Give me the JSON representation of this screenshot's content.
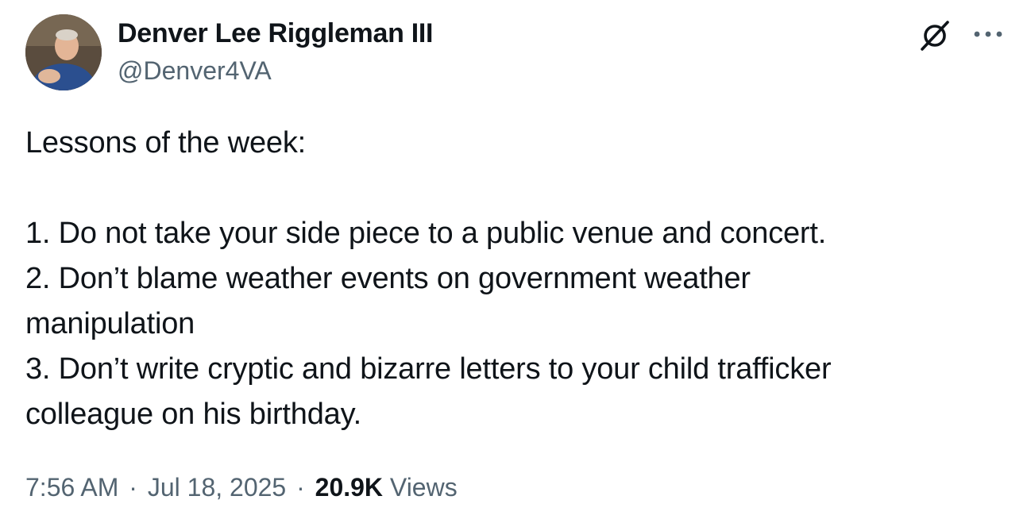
{
  "author": {
    "display_name": "Denver Lee Riggleman III",
    "handle": "@Denver4VA"
  },
  "tweet": {
    "lines": [
      "Lessons of the week:",
      "",
      "1. Do not take your side piece to a public venue and concert.",
      "2. Don’t blame weather events on government weather",
      "manipulation",
      "3. Don’t write cryptic and bizarre letters to your child trafficker",
      "colleague on his birthday."
    ]
  },
  "meta": {
    "time": "7:56 AM",
    "separator": "·",
    "date": "Jul 18, 2025",
    "views_count": "20.9K",
    "views_label": "Views"
  },
  "icons": {
    "grok": "grok-icon",
    "more": "more-options-icon",
    "avatar": "profile-avatar"
  },
  "colors": {
    "text_primary": "#0f1419",
    "text_secondary": "#536471",
    "background": "#ffffff"
  }
}
